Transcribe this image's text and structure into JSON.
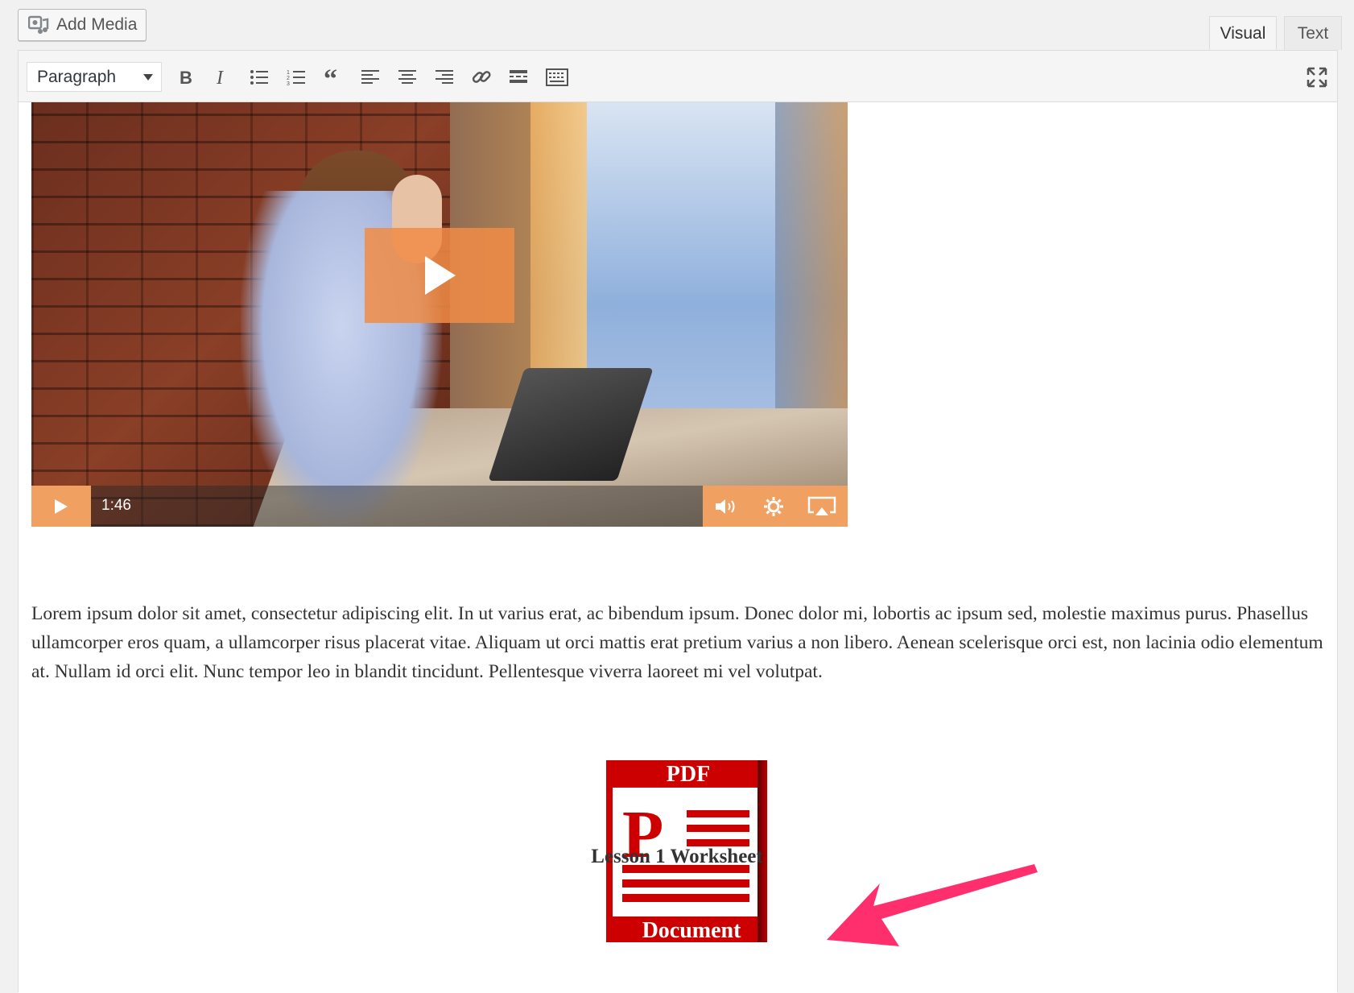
{
  "toolbar_top": {
    "add_media_label": "Add Media",
    "tabs": [
      {
        "label": "Visual",
        "active": true
      },
      {
        "label": "Text",
        "active": false
      }
    ]
  },
  "editor_toolbar": {
    "format_select": "Paragraph",
    "buttons": [
      "bold",
      "italic",
      "bulleted-list",
      "numbered-list",
      "blockquote",
      "align-left",
      "align-center",
      "align-right",
      "insert-link",
      "read-more",
      "toolbar-toggle"
    ]
  },
  "video": {
    "time": "1:46",
    "accent_color": "#f0a060"
  },
  "content": {
    "paragraph": "Lorem ipsum dolor sit amet, consectetur adipiscing elit. In ut varius erat, ac bibendum ipsum. Donec dolor mi, lobortis ac ipsum sed, molestie maximus purus. Phasellus ullamcorper eros quam, a ullamcorper risus placerat vitae. Aliquam ut orci mattis erat pretium varius a non libero. Aenean scelerisque orci est, non lacinia odio elementum at. Nullam id orci elit. Nunc tempor leo in blandit tincidunt. Pellentesque viverra laoreet mi vel volutpat.",
    "pdf_icon": {
      "top_text": "PDF",
      "bottom_text": "Document",
      "color": "#cc0000"
    },
    "caption": "Lesson 1 Worksheet",
    "arrow_color": "#ff2f6e"
  }
}
